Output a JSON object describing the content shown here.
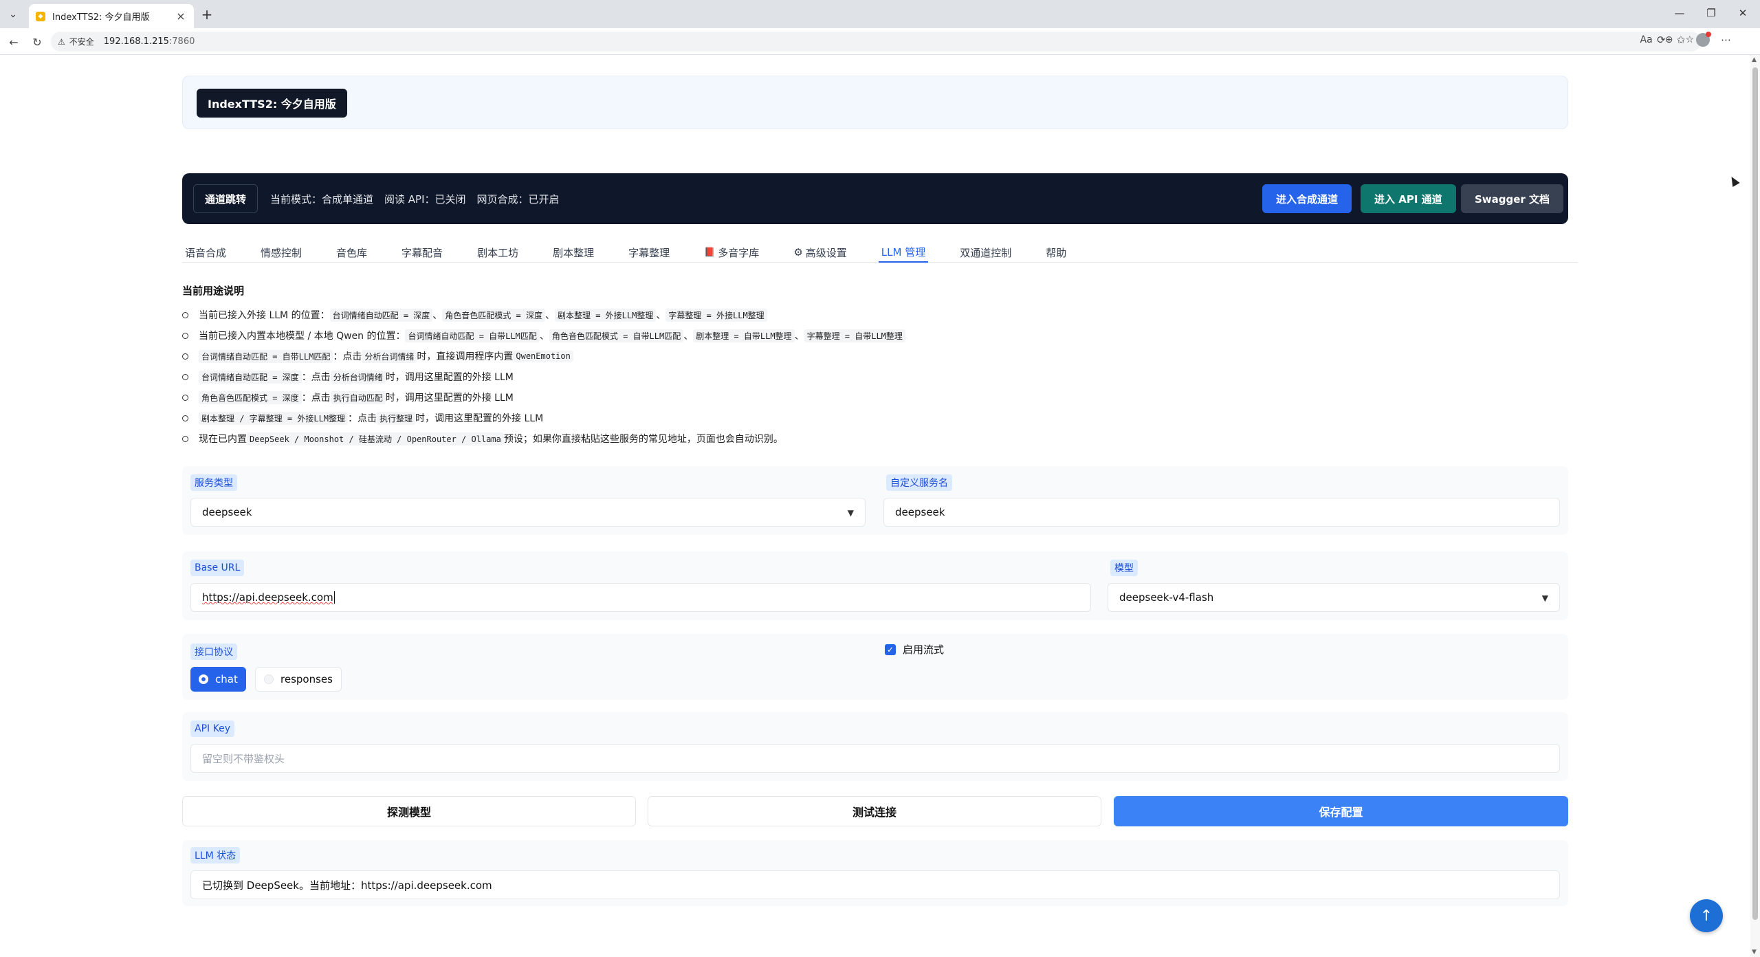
{
  "browser": {
    "tab_title": "IndexTTS2: 今夕自用版",
    "insecure_label": "不安全",
    "url_host": "192.168.1.215",
    "url_port": ":7860"
  },
  "banner": {
    "title": "IndexTTS2: 今夕自用版"
  },
  "controlbar": {
    "jump_label": "通道跳转",
    "mode": "当前模式：合成单通道",
    "read_api": "阅读 API：已关闭",
    "web_synth": "网页合成：已开启",
    "btn_synth": "进入合成通道",
    "btn_api": "进入 API 通道",
    "btn_swagger": "Swagger 文档"
  },
  "tabs": [
    "语音合成",
    "情感控制",
    "音色库",
    "字幕配音",
    "剧本工坊",
    "剧本整理",
    "字幕整理",
    "多音字库",
    "高级设置",
    "LLM 管理",
    "双通道控制",
    "帮助"
  ],
  "usage": {
    "title": "当前用途说明",
    "l1_prefix": "当前已接入外接 LLM 的位置：",
    "l1_c1": "台词情绪自动匹配 = 深度",
    "l1_c2": "角色音色匹配模式 = 深度",
    "l1_c3": "剧本整理 = 外接LLM整理",
    "l1_c4": "字幕整理 = 外接LLM整理",
    "l2_prefix": "当前已接入内置本地模型 / 本地 Qwen 的位置：",
    "l2_c1": "台词情绪自动匹配 = 自带LLM匹配",
    "l2_c2": "角色音色匹配模式 = 自带LLM匹配",
    "l2_c3": "剧本整理 = 自带LLM整理",
    "l2_c4": "字幕整理 = 自带LLM整理",
    "l3_c1": "台词情绪自动匹配 = 自带LLM匹配",
    "l3_t1": "：点击",
    "l3_c2": "分析台词情绪",
    "l3_t2": "时，直接调用程序内置",
    "l3_c3": "QwenEmotion",
    "l4_c1": "台词情绪自动匹配 = 深度",
    "l4_t1": "：点击",
    "l4_c2": "分析台词情绪",
    "l4_t2": "时，调用这里配置的外接 LLM",
    "l5_c1": "角色音色匹配模式 = 深度",
    "l5_t1": "：点击",
    "l5_c2": "执行自动匹配",
    "l5_t2": "时，调用这里配置的外接 LLM",
    "l6_c1": "剧本整理 / 字幕整理 = 外接LLM整理",
    "l6_t1": "：点击",
    "l6_c2": "执行整理",
    "l6_t2": "时，调用这里配置的外接 LLM",
    "l7_t1": "现在已内置",
    "l7_c1": "DeepSeek / Moonshot / 硅基流动 / OpenRouter / Ollama",
    "l7_t2": "预设；如果你直接粘贴这些服务的常见地址，页面也会自动识别。",
    "sep": "、"
  },
  "form": {
    "service_type_label": "服务类型",
    "service_type_value": "deepseek",
    "custom_name_label": "自定义服务名",
    "custom_name_value": "deepseek",
    "base_url_label": "Base URL",
    "base_url_value": "https://api.deepseek.com",
    "model_label": "模型",
    "model_value": "deepseek-v4-flash",
    "protocol_label": "接口协议",
    "protocol_chat": "chat",
    "protocol_responses": "responses",
    "stream_label": "启用流式",
    "api_key_label": "API Key",
    "api_key_placeholder": "留空则不带鉴权头"
  },
  "actions": {
    "probe": "探测模型",
    "test": "测试连接",
    "save": "保存配置"
  },
  "status": {
    "label": "LLM 状态",
    "text": "已切换到 DeepSeek。当前地址：https://api.deepseek.com"
  },
  "colors": {
    "primary": "#2563eb",
    "api_green": "#0f766e",
    "dark": "#0f172a"
  }
}
